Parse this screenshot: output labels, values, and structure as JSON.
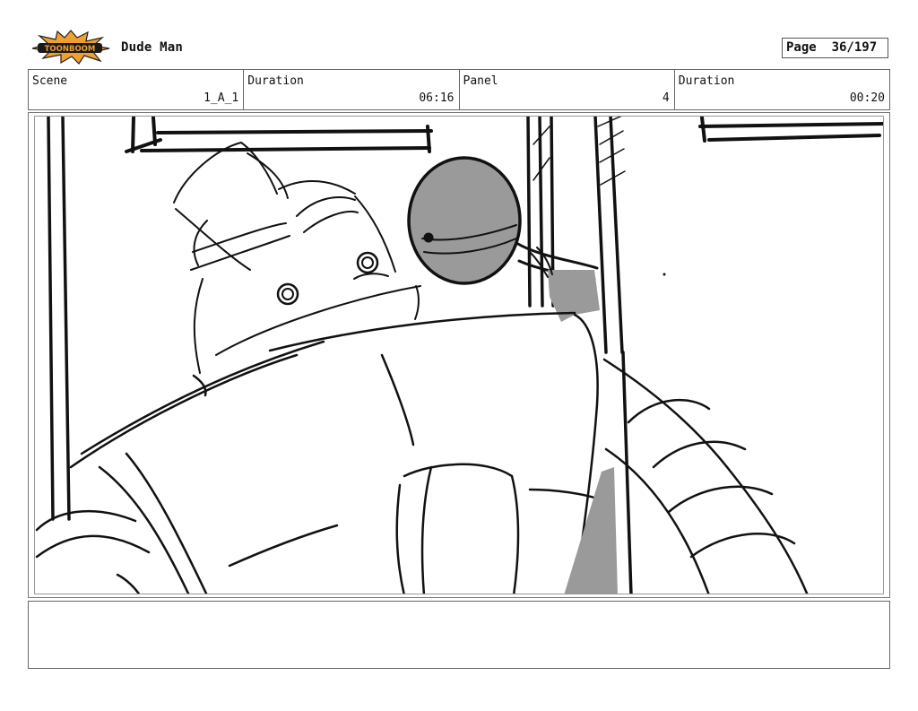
{
  "header": {
    "logo_text": "TOONBOOM",
    "project_title": "Dude Man",
    "page_label": "Page",
    "page_value": "36/197"
  },
  "info": {
    "scene_label": "Scene",
    "scene_value": "1_A_1",
    "duration_label": "Duration",
    "duration_value": "06:16",
    "panel_label": "Panel",
    "panel_value": "4",
    "panel_duration_label": "Duration",
    "panel_duration_value": "00:20"
  },
  "colors": {
    "logo_burst": "#f0a030",
    "sketch_gray": "#9a9a9a",
    "line": "#111111"
  },
  "notes": {
    "text": ""
  }
}
